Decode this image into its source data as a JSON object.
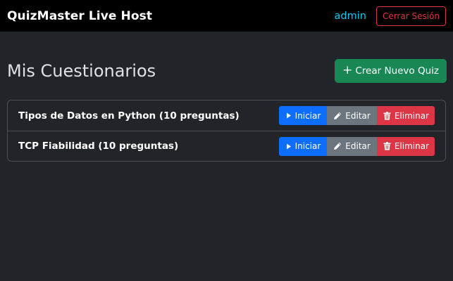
{
  "navbar": {
    "brand": "QuizMaster Live Host",
    "user": "admin",
    "logout_label": "Cerrar Sesión"
  },
  "main": {
    "title": "Mis Cuestionarios",
    "create_label": "Crear Nuevo Quiz",
    "create_icon": "plus-icon"
  },
  "quizzes": [
    {
      "title": "Tipos de Datos en Python (10 preguntas)",
      "start_label": "Iniciar",
      "edit_label": "Editar",
      "delete_label": "Eliminar"
    },
    {
      "title": "TCP Fiabilidad (10 preguntas)",
      "start_label": "Iniciar",
      "edit_label": "Editar",
      "delete_label": "Eliminar"
    }
  ],
  "colors": {
    "background": "#212529",
    "navbar": "#000000",
    "primary": "#0d6efd",
    "secondary": "#6c757d",
    "success": "#198754",
    "danger": "#dc3545",
    "info": "#0dcaf0"
  }
}
